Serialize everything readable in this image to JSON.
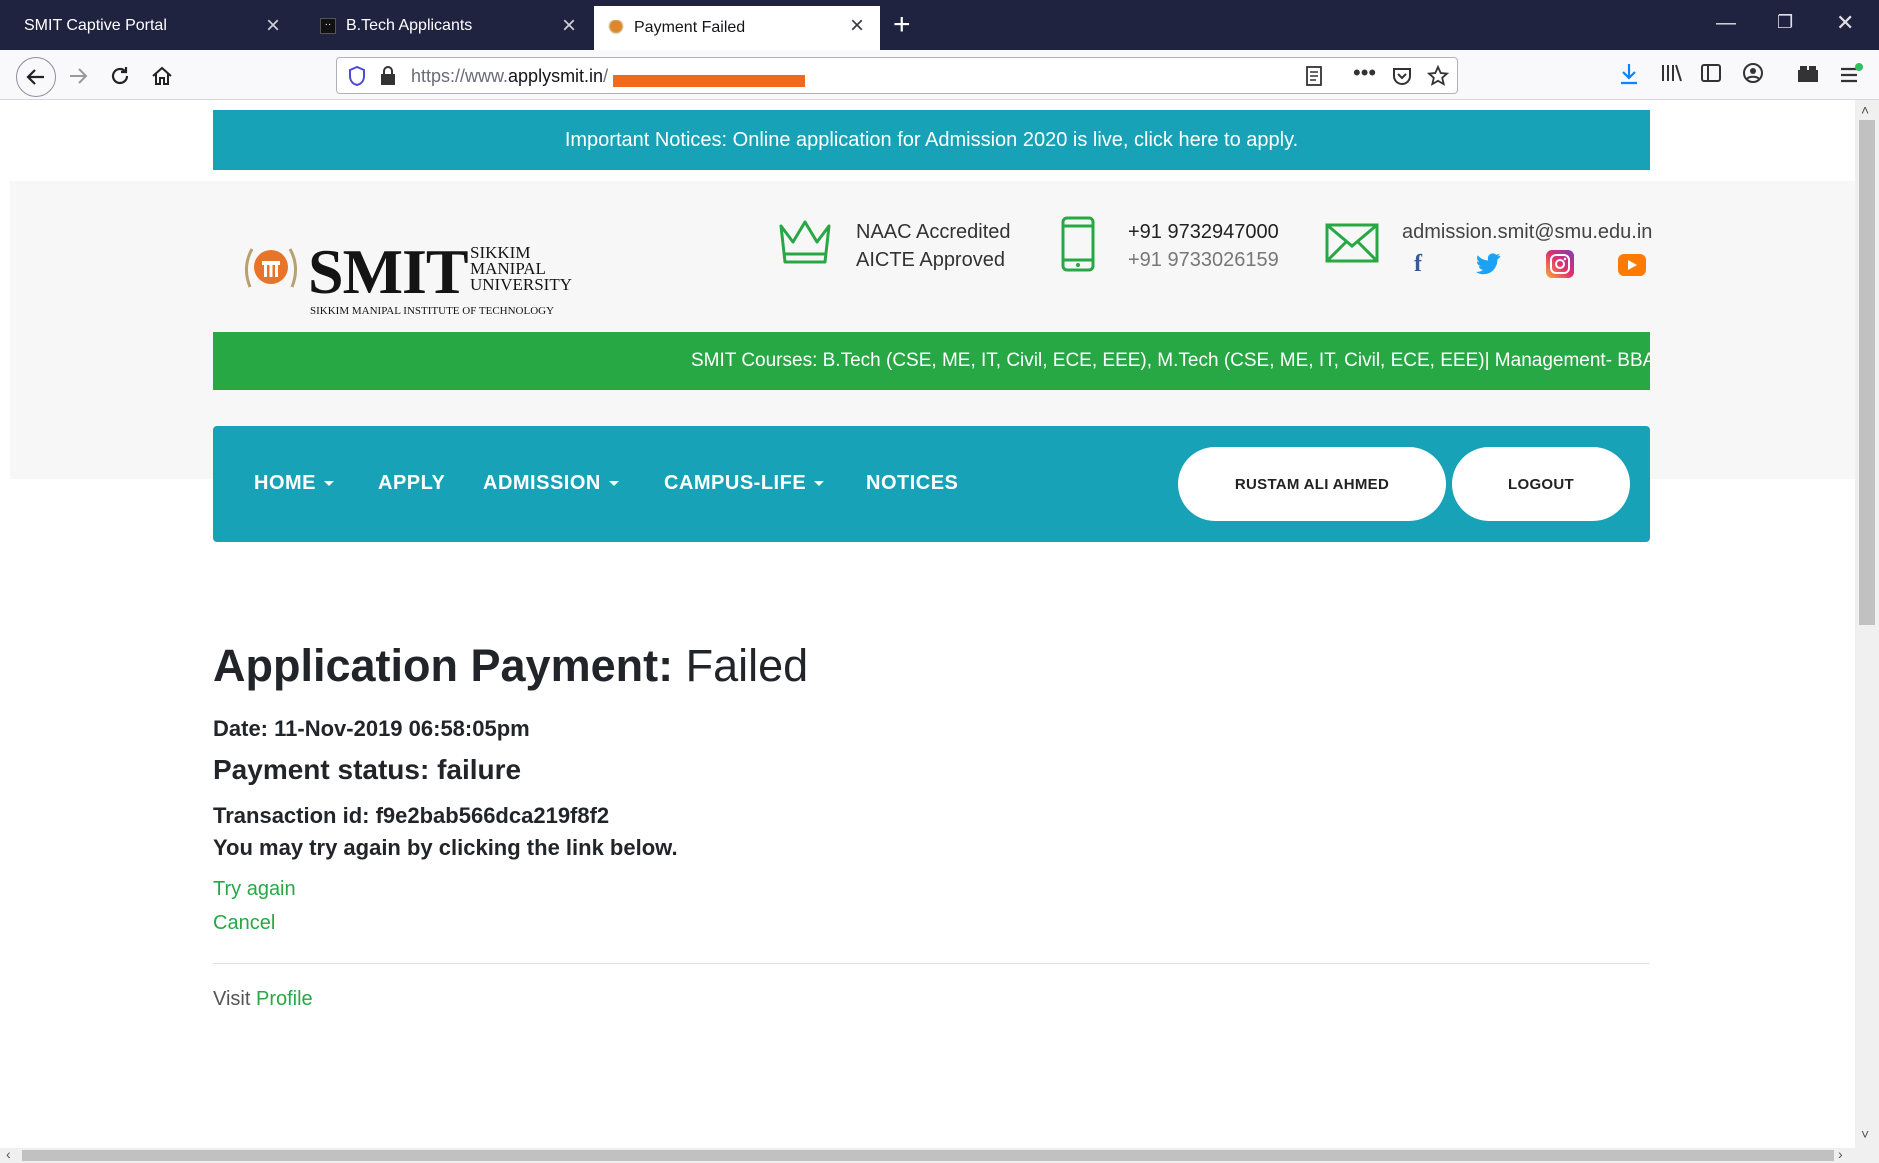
{
  "browser": {
    "tabs": [
      {
        "title": "SMIT Captive Portal"
      },
      {
        "title": "B.Tech Applicants"
      },
      {
        "title": "Payment Failed"
      }
    ],
    "url_prefix": "https://www.",
    "url_host": "applysmit.in",
    "url_path": "/"
  },
  "notice": "Important Notices: Online application for Admission 2020 is live, click here to apply.",
  "header": {
    "logo": {
      "word": "SMIT",
      "sub_line1": "SIKKIM",
      "sub_line2": "MANIPAL",
      "sub_line3": "UNIVERSITY",
      "tagline": "SIKKIM MANIPAL INSTITUTE OF TECHNOLOGY"
    },
    "accreditation": {
      "line1": "NAAC Accredited",
      "line2": "AICTE Approved"
    },
    "phones": {
      "line1": "+91 9732947000",
      "line2": "+91 9733026159"
    },
    "email": "admission.smit@smu.edu.in"
  },
  "courses": "SMIT Courses: B.Tech (CSE, ME, IT, Civil, ECE, EEE), M.Tech (CSE, ME, IT, Civil, ECE, EEE)| Management- BBA,",
  "nav": {
    "home": "HOME",
    "apply": "APPLY",
    "admission": "ADMISSION",
    "campus": "CAMPUS-LIFE",
    "notices": "NOTICES",
    "user": "RUSTAM ALI AHMED",
    "logout": "LOGOUT"
  },
  "payment": {
    "title_bold": "Application Payment:",
    "title_status": " Failed",
    "date": "Date: 11-Nov-2019 06:58:05pm",
    "status": "Payment status: failure",
    "transaction": "Transaction id: f9e2bab566dca219f8f2",
    "retry_msg": "You may try again by clicking the link below.",
    "try_again": "Try again",
    "cancel": "Cancel",
    "visit_label": "Visit ",
    "profile_link": "Profile"
  },
  "colors": {
    "teal": "#17a2b8",
    "green": "#28a745",
    "chrome_dark": "#202340"
  }
}
